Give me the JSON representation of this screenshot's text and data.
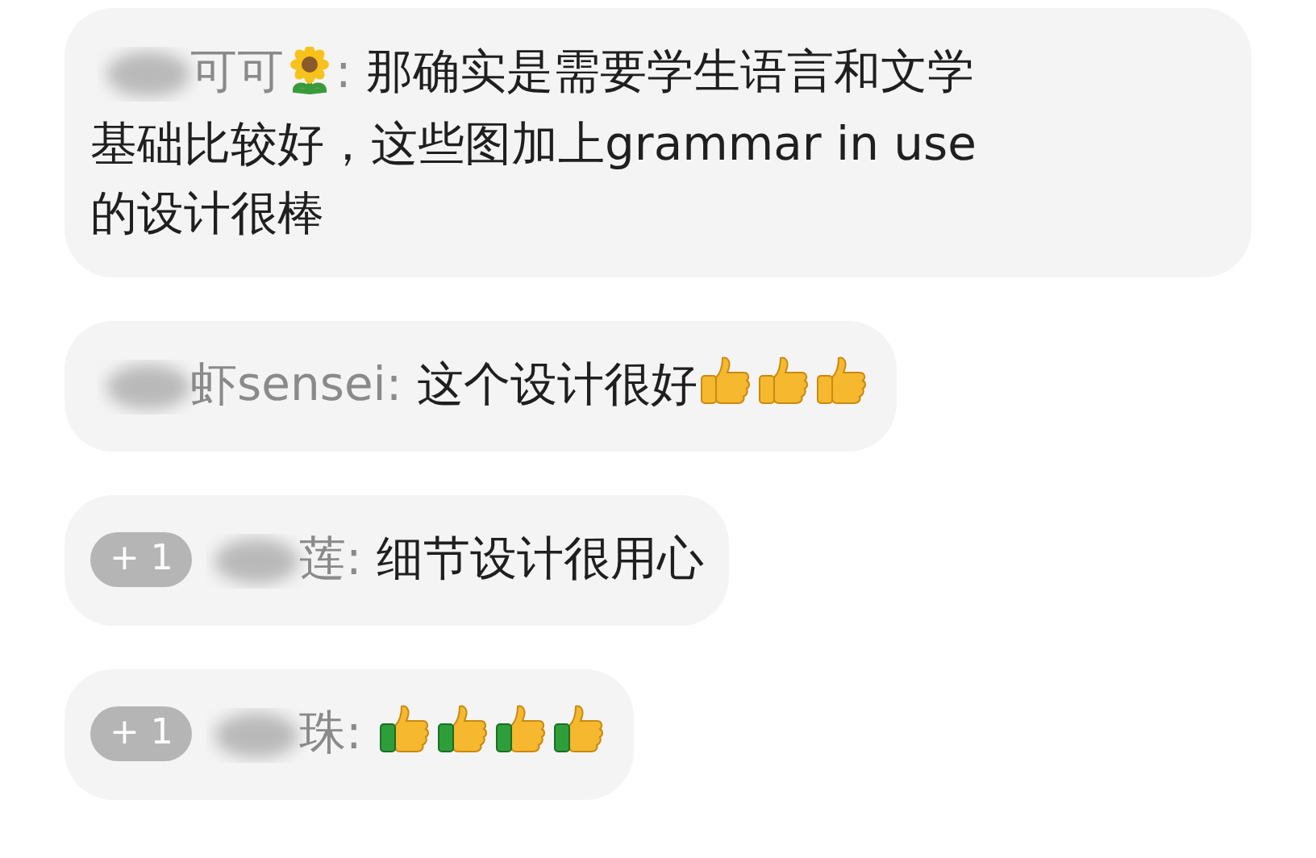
{
  "comments": [
    {
      "name_parts": [
        {
          "kind": "text",
          "text": "可可"
        },
        {
          "kind": "sunflower"
        },
        {
          "kind": "text",
          "text": ":"
        }
      ],
      "parts": [
        {
          "kind": "text",
          "text": "那确实是需要学生语言和文学"
        },
        {
          "kind": "line",
          "text": "基础比较好，这些图加上grammar in use"
        },
        {
          "kind": "line",
          "text": "的设计很棒"
        }
      ]
    },
    {
      "name_parts": [
        {
          "kind": "text",
          "text": "虾sensei:"
        }
      ],
      "parts": [
        {
          "kind": "text",
          "text": "这个设计很好"
        },
        {
          "kind": "thumb"
        },
        {
          "kind": "thumb"
        },
        {
          "kind": "thumb"
        }
      ]
    },
    {
      "badge": "+ 1",
      "name_parts": [
        {
          "kind": "text",
          "text": "莲:"
        }
      ],
      "parts": [
        {
          "kind": "text",
          "text": "细节设计很用心"
        }
      ]
    },
    {
      "badge": "+ 1",
      "name_parts": [
        {
          "kind": "text",
          "text": "珠:"
        }
      ],
      "parts": [
        {
          "kind": "thumb-cuff"
        },
        {
          "kind": "thumb-cuff"
        },
        {
          "kind": "thumb-cuff"
        },
        {
          "kind": "thumb-cuff"
        }
      ]
    }
  ]
}
